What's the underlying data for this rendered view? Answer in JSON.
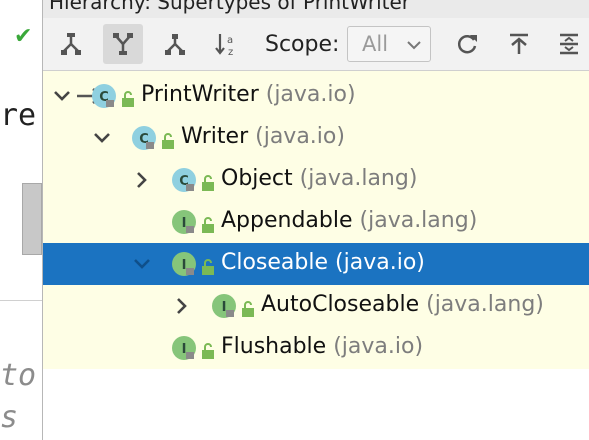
{
  "popup": {
    "title": "Hierarchy: Supertypes of PrintWriter"
  },
  "toolbar": {
    "buttons": [
      {
        "name": "subtypes-hierarchy-icon",
        "active": false
      },
      {
        "name": "supertypes-hierarchy-icon",
        "active": true
      },
      {
        "name": "class-hierarchy-icon",
        "active": false
      },
      {
        "name": "sort-alphabetically-icon",
        "active": false
      }
    ],
    "scope_label": "Scope:",
    "scope_value": "All",
    "right_buttons": [
      "refresh-icon",
      "export-icon",
      "expand-all-icon"
    ]
  },
  "tree": {
    "rows": [
      {
        "name": "PrintWriter",
        "package": "(java.io)",
        "kind": "C",
        "arrow": "down",
        "current": true,
        "depth": 0,
        "selected": false
      },
      {
        "name": "Writer",
        "package": "(java.io)",
        "kind": "C",
        "arrow": "down",
        "depth": 1,
        "selected": false
      },
      {
        "name": "Object",
        "package": "(java.lang)",
        "kind": "C",
        "arrow": "right",
        "depth": 2,
        "selected": false
      },
      {
        "name": "Appendable",
        "package": "(java.lang)",
        "kind": "I",
        "arrow": "none",
        "depth": 2,
        "selected": false
      },
      {
        "name": "Closeable",
        "package": "(java.io)",
        "kind": "I",
        "arrow": "down",
        "depth": 2,
        "selected": true
      },
      {
        "name": "AutoCloseable",
        "package": "(java.lang)",
        "kind": "I",
        "arrow": "right",
        "depth": 3,
        "selected": false
      },
      {
        "name": "Flushable",
        "package": "(java.io)",
        "kind": "I",
        "arrow": "none",
        "depth": 2,
        "selected": false
      }
    ]
  },
  "editor": {
    "line1": "re",
    "line2": "to",
    "line3": "s"
  },
  "colors": {
    "selection": "#1b73c1",
    "tree_bg": "#fefee5",
    "class_icon": "#8fd0e0",
    "interface_icon": "#86c57a",
    "lock": "#7bb955"
  }
}
